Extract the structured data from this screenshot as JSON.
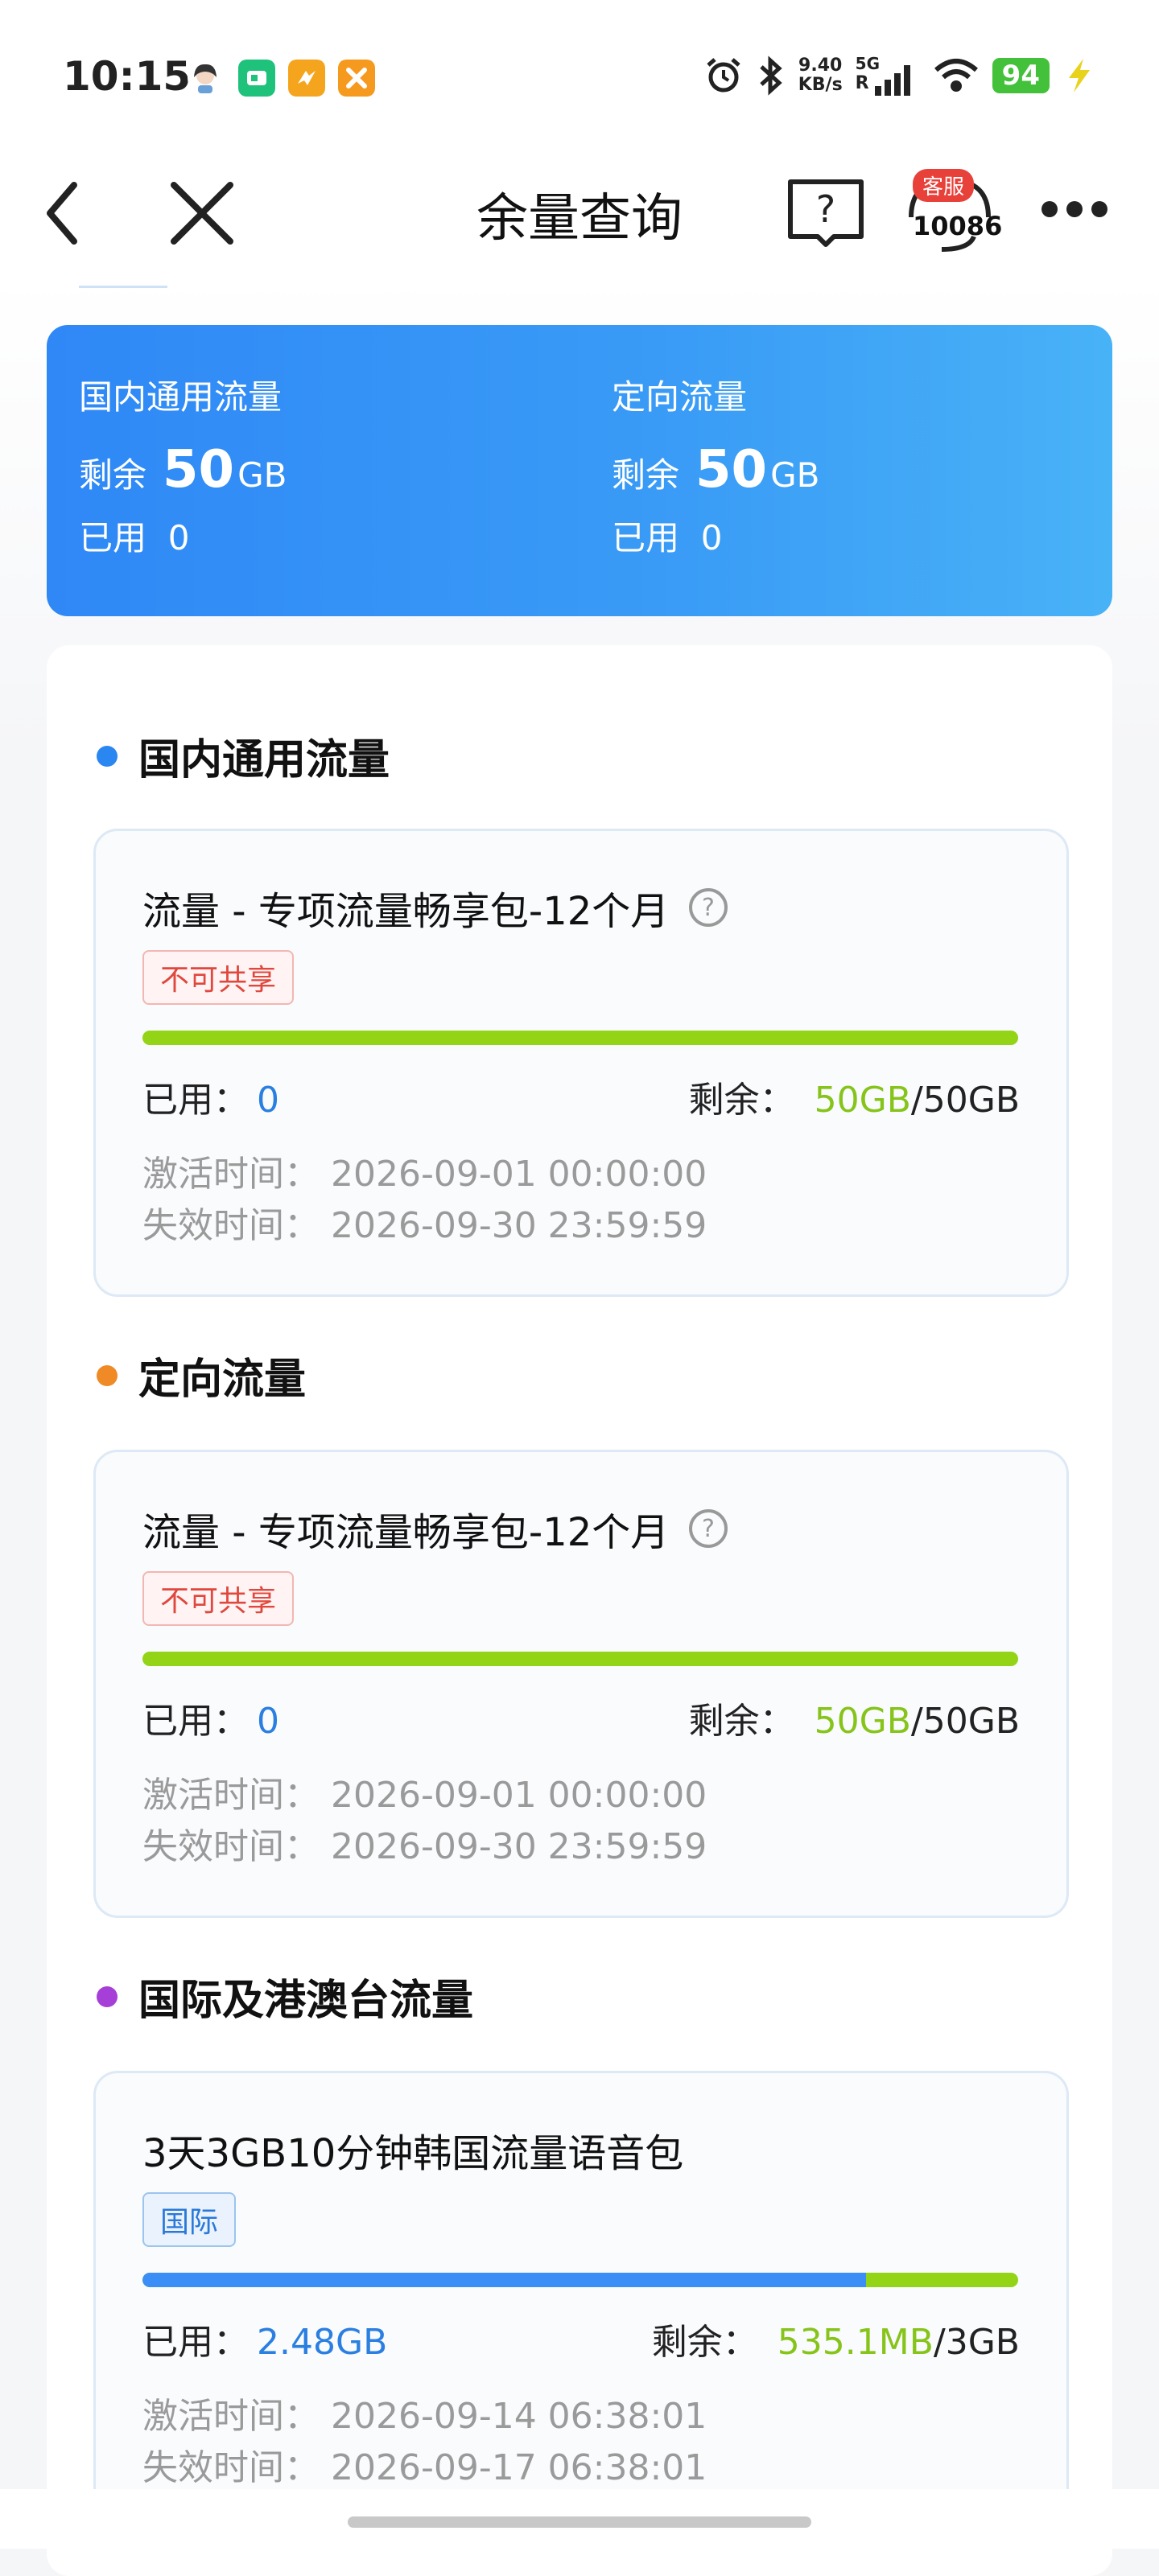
{
  "status_bar": {
    "time": "10:15",
    "net_speed_value": "9.40",
    "net_speed_unit": "KB/s",
    "signal_label": "5G",
    "signal_sub": "R",
    "battery": "94",
    "icons": [
      "avatar-icon",
      "app-green-icon",
      "app-orange-icon",
      "app-tools-icon",
      "alarm-icon",
      "bluetooth-icon",
      "signal-icon",
      "wifi-icon",
      "battery-icon",
      "charging-icon"
    ]
  },
  "titlebar": {
    "title": "余量查询",
    "cs_badge": "客服",
    "cs_number": "10086"
  },
  "summary": {
    "cols": [
      {
        "title": "国内通用流量",
        "remain_label": "剩余",
        "remain_value": "50",
        "remain_unit": "GB",
        "used_label": "已用",
        "used_value": "0"
      },
      {
        "title": "定向流量",
        "remain_label": "剩余",
        "remain_value": "50",
        "remain_unit": "GB",
        "used_label": "已用",
        "used_value": "0"
      }
    ]
  },
  "sections": [
    {
      "title": "国内通用流量",
      "dot_color": "#2a86f0",
      "card": {
        "name": "流量 - 专项流量畅享包-12个月",
        "tag": "不可共享",
        "used_label": "已用：",
        "used": "0",
        "remain_label": "剩余：",
        "remain": "50GB",
        "total": "/50GB",
        "used_fraction": 0,
        "activate": "激活时间：  2026-09-01 00:00:00",
        "expire": "失效时间：  2026-09-30 23:59:59"
      }
    },
    {
      "title": "定向流量",
      "dot_color": "#f08a26",
      "card": {
        "name": "流量 - 专项流量畅享包-12个月",
        "tag": "不可共享",
        "used_label": "已用：",
        "used": "0",
        "remain_label": "剩余：",
        "remain": "50GB",
        "total": "/50GB",
        "used_fraction": 0,
        "activate": "激活时间：  2026-09-01 00:00:00",
        "expire": "失效时间：  2026-09-30 23:59:59"
      }
    },
    {
      "title": "国际及港澳台流量",
      "dot_color": "#a63fd8",
      "card": {
        "name": "3天3GB10分钟韩国流量语音包",
        "tag": "国际",
        "used_label": "已用：",
        "used": "2.48GB",
        "remain_label": "剩余：",
        "remain": "535.1MB",
        "total": "/3GB",
        "used_fraction": 0.826,
        "activate": "激活时间：  2026-09-14 06:38:01",
        "expire": "失效时间：  2026-09-17 06:38:01"
      }
    }
  ]
}
